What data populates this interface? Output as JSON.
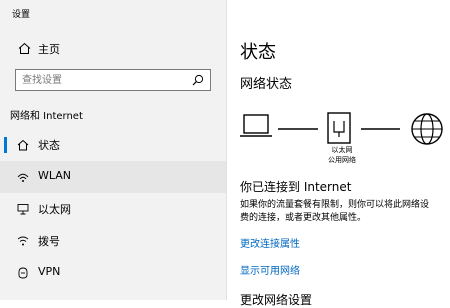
{
  "app": {
    "title": "设置"
  },
  "sidebar": {
    "home_label": "主页",
    "search_placeholder": "查找设置",
    "section_label": "网络和 Internet",
    "items": [
      {
        "label": "状态",
        "icon": "home-icon",
        "selected": false
      },
      {
        "label": "WLAN",
        "icon": "wifi-icon",
        "selected": true
      },
      {
        "label": "以太网",
        "icon": "ethernet-icon",
        "selected": false
      },
      {
        "label": "拨号",
        "icon": "dialup-icon",
        "selected": false
      },
      {
        "label": "VPN",
        "icon": "vpn-icon",
        "selected": false
      }
    ]
  },
  "main": {
    "title": "状态",
    "network_status_heading": "网络状态",
    "diagram_caption_line1": "以太网",
    "diagram_caption_line2": "公用网络",
    "connection_status": "你已连接到 Internet",
    "description_line1": "如果你的流量套餐有限制，则你可以将此网络设",
    "description_line2": "费的连接，或者更改其他属性。",
    "link_change_properties": "更改连接属性",
    "link_show_networks": "显示可用网络",
    "next_section_heading": "更改网络设置"
  },
  "colors": {
    "accent": "#0078d7",
    "link": "#0067c0",
    "sidebar_bg": "#f2f2f2",
    "selected_bg": "#e6e6e6"
  }
}
